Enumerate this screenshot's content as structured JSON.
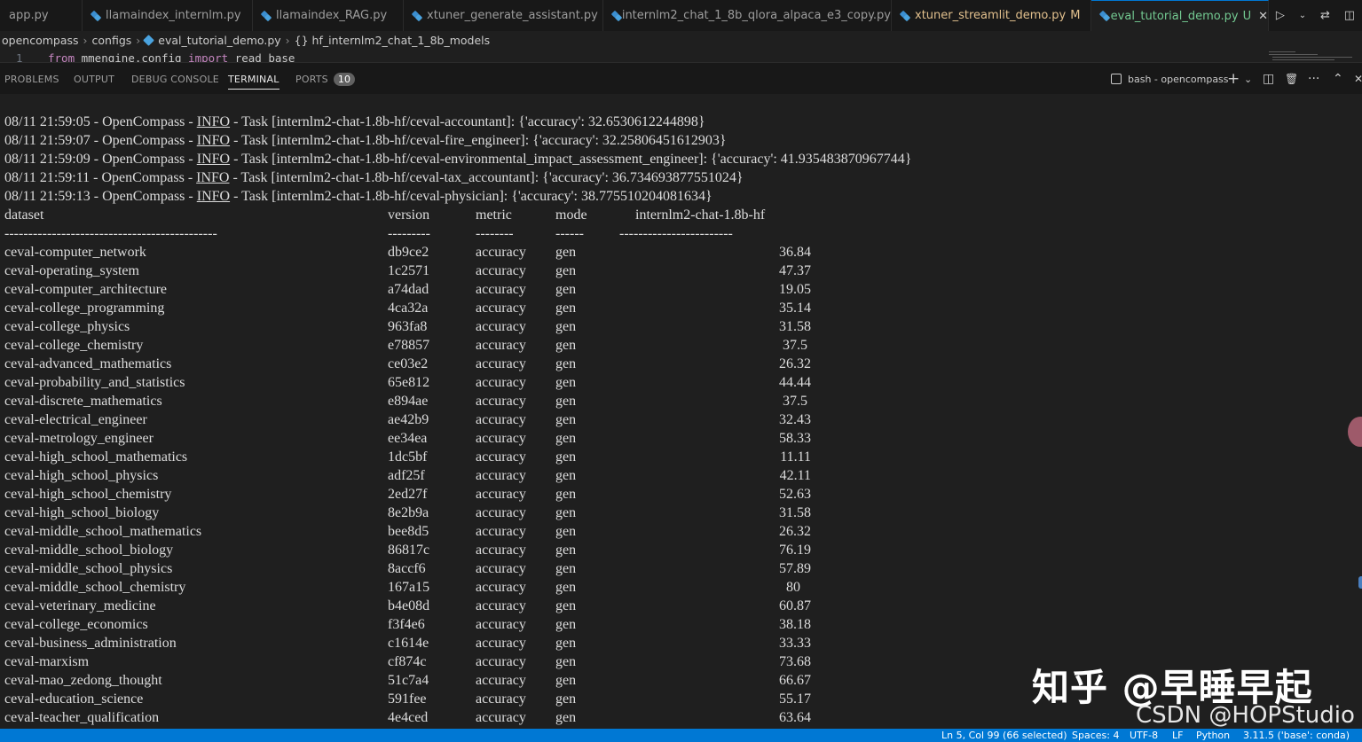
{
  "tabs": [
    {
      "label": "app.py",
      "badge": "",
      "icon": "none"
    },
    {
      "label": "llamaindex_internlm.py",
      "badge": "",
      "icon": "python-icon"
    },
    {
      "label": "llamaindex_RAG.py",
      "badge": "",
      "icon": "python-icon"
    },
    {
      "label": "xtuner_generate_assistant.py",
      "badge": "",
      "icon": "python-icon"
    },
    {
      "label": "internlm2_chat_1_8b_qlora_alpaca_e3_copy.py",
      "badge": "",
      "icon": "python-icon"
    },
    {
      "label": "xtuner_streamlit_demo.py",
      "badge": "M",
      "icon": "python-icon"
    },
    {
      "label": "eval_tutorial_demo.py",
      "badge": "U",
      "icon": "python-icon"
    }
  ],
  "tab_actions": [
    "run-icon",
    "dropdown-icon",
    "compare-icon",
    "split-editor-icon",
    "more-icon"
  ],
  "breadcrumb": [
    "opencompass",
    "configs",
    "eval_tutorial_demo.py",
    "{} hf_internlm2_chat_1_8b_models"
  ],
  "editor": {
    "line_number": "1",
    "kw1": "from",
    "module": " mmengine.config ",
    "kw2": "import",
    "name": " read_base"
  },
  "panel": {
    "tabs": [
      "PROBLEMS",
      "OUTPUT",
      "DEBUG CONSOLE",
      "TERMINAL",
      "PORTS"
    ],
    "ports_count": "10",
    "terminal_name": "bash - opencompass",
    "actions": [
      "+",
      "⌄",
      "◫",
      "🗑",
      "···",
      "⌃",
      "✕"
    ]
  },
  "log": [
    {
      "ts": "08/11 21:59:05",
      "src": "OpenCompass",
      "level": "INFO",
      "msg": "Task [internlm2-chat-1.8b-hf/ceval-accountant]: {'accuracy': 32.6530612244898}"
    },
    {
      "ts": "08/11 21:59:07",
      "src": "OpenCompass",
      "level": "INFO",
      "msg": "Task [internlm2-chat-1.8b-hf/ceval-fire_engineer]: {'accuracy': 32.25806451612903}"
    },
    {
      "ts": "08/11 21:59:09",
      "src": "OpenCompass",
      "level": "INFO",
      "msg": "Task [internlm2-chat-1.8b-hf/ceval-environmental_impact_assessment_engineer]: {'accuracy': 41.935483870967744}"
    },
    {
      "ts": "08/11 21:59:11",
      "src": "OpenCompass",
      "level": "INFO",
      "msg": "Task [internlm2-chat-1.8b-hf/ceval-tax_accountant]: {'accuracy': 36.734693877551024}"
    },
    {
      "ts": "08/11 21:59:13",
      "src": "OpenCompass",
      "level": "INFO",
      "msg": "Task [internlm2-chat-1.8b-hf/ceval-physician]: {'accuracy': 38.775510204081634}"
    }
  ],
  "table": {
    "headers": [
      "dataset",
      "version",
      "metric",
      "mode",
      "internlm2-chat-1.8b-hf"
    ],
    "dashes": [
      "---------------------------------------------",
      "---------",
      "--------",
      "------",
      "------------------------"
    ],
    "rows": [
      [
        "ceval-computer_network",
        "db9ce2",
        "accuracy",
        "gen",
        "36.84"
      ],
      [
        "ceval-operating_system",
        "1c2571",
        "accuracy",
        "gen",
        "47.37"
      ],
      [
        "ceval-computer_architecture",
        "a74dad",
        "accuracy",
        "gen",
        "19.05"
      ],
      [
        "ceval-college_programming",
        "4ca32a",
        "accuracy",
        "gen",
        "35.14"
      ],
      [
        "ceval-college_physics",
        "963fa8",
        "accuracy",
        "gen",
        "31.58"
      ],
      [
        "ceval-college_chemistry",
        "e78857",
        "accuracy",
        "gen",
        "37.5 "
      ],
      [
        "ceval-advanced_mathematics",
        "ce03e2",
        "accuracy",
        "gen",
        "26.32"
      ],
      [
        "ceval-probability_and_statistics",
        "65e812",
        "accuracy",
        "gen",
        "44.44"
      ],
      [
        "ceval-discrete_mathematics",
        "e894ae",
        "accuracy",
        "gen",
        "37.5 "
      ],
      [
        "ceval-electrical_engineer",
        "ae42b9",
        "accuracy",
        "gen",
        "32.43"
      ],
      [
        "ceval-metrology_engineer",
        "ee34ea",
        "accuracy",
        "gen",
        "58.33"
      ],
      [
        "ceval-high_school_mathematics",
        "1dc5bf",
        "accuracy",
        "gen",
        "11.11"
      ],
      [
        "ceval-high_school_physics",
        "adf25f",
        "accuracy",
        "gen",
        "42.11"
      ],
      [
        "ceval-high_school_chemistry",
        "2ed27f",
        "accuracy",
        "gen",
        "52.63"
      ],
      [
        "ceval-high_school_biology",
        "8e2b9a",
        "accuracy",
        "gen",
        "31.58"
      ],
      [
        "ceval-middle_school_mathematics",
        "bee8d5",
        "accuracy",
        "gen",
        "26.32"
      ],
      [
        "ceval-middle_school_biology",
        "86817c",
        "accuracy",
        "gen",
        "76.19"
      ],
      [
        "ceval-middle_school_physics",
        "8accf6",
        "accuracy",
        "gen",
        "57.89"
      ],
      [
        "ceval-middle_school_chemistry",
        "167a15",
        "accuracy",
        "gen",
        "80   "
      ],
      [
        "ceval-veterinary_medicine",
        "b4e08d",
        "accuracy",
        "gen",
        "60.87"
      ],
      [
        "ceval-college_economics",
        "f3f4e6",
        "accuracy",
        "gen",
        "38.18"
      ],
      [
        "ceval-business_administration",
        "c1614e",
        "accuracy",
        "gen",
        "33.33"
      ],
      [
        "ceval-marxism",
        "cf874c",
        "accuracy",
        "gen",
        "73.68"
      ],
      [
        "ceval-mao_zedong_thought",
        "51c7a4",
        "accuracy",
        "gen",
        "66.67"
      ],
      [
        "ceval-education_science",
        "591fee",
        "accuracy",
        "gen",
        "55.17"
      ],
      [
        "ceval-teacher_qualification",
        "4e4ced",
        "accuracy",
        "gen",
        "63.64"
      ]
    ]
  },
  "watermark": {
    "zhihu": "知乎 @早睡早起",
    "csdn": "CSDN @HOPStudio"
  },
  "statusbar": {
    "position": "Ln 5, Col 99 (66 selected)",
    "spaces": "Spaces: 4",
    "encoding": "UTF-8",
    "eol": "LF",
    "language": "Python",
    "interpreter": "3.11.5 ('base': conda)"
  },
  "colors": {
    "accent": "#0078d4",
    "modified": "#e2c08d",
    "untracked": "#73c991"
  }
}
